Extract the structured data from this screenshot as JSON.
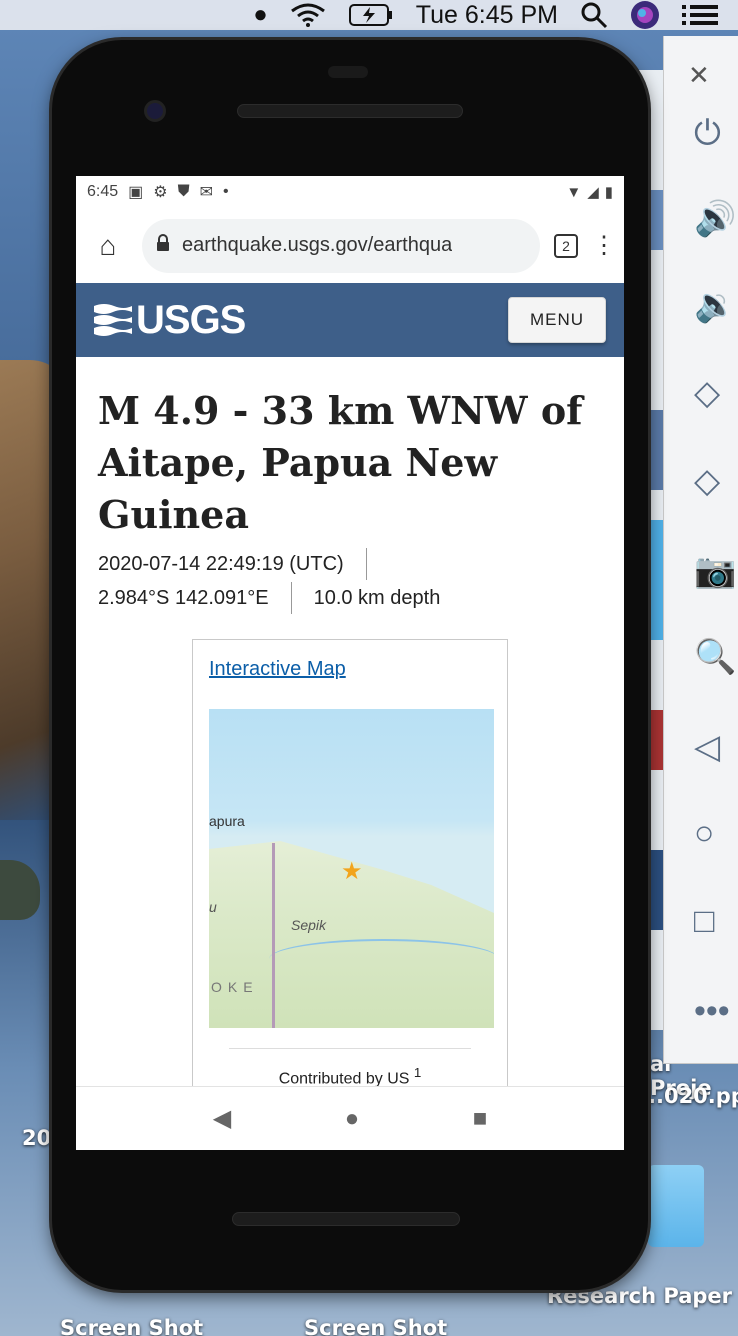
{
  "mac_menubar": {
    "clock": "Tue 6:45 PM"
  },
  "desktop": {
    "labels": [
      "20",
      "Screen Shot",
      "Screen Shot",
      "Research Paper",
      "al Proje",
      "..020.pp"
    ]
  },
  "android_status": {
    "time": "6:45"
  },
  "browser": {
    "url": "earthquake.usgs.gov/earthqua",
    "tab_count": "2"
  },
  "usgs": {
    "logo_text": "USGS",
    "menu_label": "MENU"
  },
  "event": {
    "title": "M 4.9 - 33 km WNW of Aitape, Papua New Guinea",
    "time": "2020-07-14 22:49:19 (UTC)",
    "location": "2.984°S 142.091°E",
    "depth": "10.0 km depth"
  },
  "map_card": {
    "link_label": "Interactive Map",
    "map_labels": [
      "apura",
      "Sepik",
      "u",
      "OKE"
    ],
    "contributed": "Contributed by US",
    "contributed_sup": "1"
  },
  "colors": {
    "usgs_header": "#3e5f89",
    "link": "#0b5ea8",
    "marker": "#f2a41c"
  }
}
